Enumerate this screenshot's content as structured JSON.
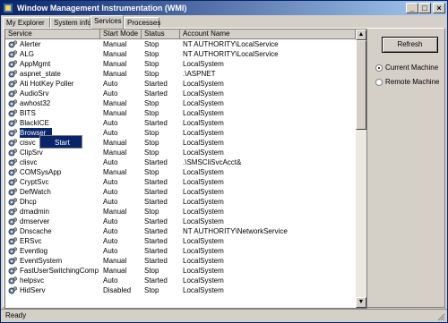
{
  "window": {
    "title": "Window Management Instrumentation (WMI)"
  },
  "tabs": [
    {
      "label": "My Explorer",
      "active": false
    },
    {
      "label": "System info",
      "active": false
    },
    {
      "label": "Services",
      "active": true
    },
    {
      "label": "Processes",
      "active": false
    }
  ],
  "table": {
    "headers": {
      "service": "Service",
      "start_mode": "Start Mode",
      "status": "Status",
      "account": "Account Name"
    },
    "rows": [
      {
        "service": "Alerter",
        "start_mode": "Manual",
        "status": "Stop",
        "account": "NT AUTHORITY\\LocalService"
      },
      {
        "service": "ALG",
        "start_mode": "Manual",
        "status": "Stop",
        "account": "NT AUTHORITY\\LocalService"
      },
      {
        "service": "AppMgmt",
        "start_mode": "Manual",
        "status": "Stop",
        "account": "LocalSystem"
      },
      {
        "service": "aspnet_state",
        "start_mode": "Manual",
        "status": "Stop",
        "account": ".\\ASPNET"
      },
      {
        "service": "Ati HotKey Poller",
        "start_mode": "Auto",
        "status": "Started",
        "account": "LocalSystem"
      },
      {
        "service": "AudioSrv",
        "start_mode": "Auto",
        "status": "Started",
        "account": "LocalSystem"
      },
      {
        "service": "awhost32",
        "start_mode": "Manual",
        "status": "Stop",
        "account": "LocalSystem"
      },
      {
        "service": "BITS",
        "start_mode": "Manual",
        "status": "Stop",
        "account": "LocalSystem"
      },
      {
        "service": "BlackICE",
        "start_mode": "Auto",
        "status": "Started",
        "account": "LocalSystem"
      },
      {
        "service": "Browser",
        "start_mode": "Auto",
        "status": "Stop",
        "account": "LocalSystem",
        "selected": true
      },
      {
        "service": "cisvc",
        "start_mode": "Manual",
        "status": "Stop",
        "account": "LocalSystem"
      },
      {
        "service": "ClipSrv",
        "start_mode": "Manual",
        "status": "Stop",
        "account": "LocalSystem"
      },
      {
        "service": "clisvc",
        "start_mode": "Auto",
        "status": "Started",
        "account": ".\\SMSCliSvcAcct&"
      },
      {
        "service": "COMSysApp",
        "start_mode": "Manual",
        "status": "Stop",
        "account": "LocalSystem"
      },
      {
        "service": "CryptSvc",
        "start_mode": "Auto",
        "status": "Started",
        "account": "LocalSystem"
      },
      {
        "service": "DefWatch",
        "start_mode": "Auto",
        "status": "Started",
        "account": "LocalSystem"
      },
      {
        "service": "Dhcp",
        "start_mode": "Auto",
        "status": "Started",
        "account": "LocalSystem"
      },
      {
        "service": "dmadmin",
        "start_mode": "Manual",
        "status": "Stop",
        "account": "LocalSystem"
      },
      {
        "service": "dmserver",
        "start_mode": "Auto",
        "status": "Started",
        "account": "LocalSystem"
      },
      {
        "service": "Dnscache",
        "start_mode": "Auto",
        "status": "Started",
        "account": "NT AUTHORITY\\NetworkService"
      },
      {
        "service": "ERSvc",
        "start_mode": "Auto",
        "status": "Started",
        "account": "LocalSystem"
      },
      {
        "service": "Eventlog",
        "start_mode": "Auto",
        "status": "Started",
        "account": "LocalSystem"
      },
      {
        "service": "EventSystem",
        "start_mode": "Manual",
        "status": "Started",
        "account": "LocalSystem"
      },
      {
        "service": "FastUserSwitchingComp...",
        "start_mode": "Manual",
        "status": "Stop",
        "account": "LocalSystem"
      },
      {
        "service": "helpsvc",
        "start_mode": "Auto",
        "status": "Started",
        "account": "LocalSystem"
      },
      {
        "service": "HidServ",
        "start_mode": "Disabled",
        "status": "Stop",
        "account": "LocalSystem"
      }
    ]
  },
  "context_menu": {
    "item": "Start"
  },
  "actions": {
    "refresh_label": "Refresh"
  },
  "machine": {
    "options": [
      {
        "label": "Current Machine",
        "selected": true
      },
      {
        "label": "Remote Machine",
        "selected": false
      }
    ]
  },
  "statusbar": {
    "text": "Ready"
  },
  "colors": {
    "title_start": "#0a246a",
    "title_end": "#a6caf0",
    "face": "#d4d0c8",
    "selection": "#0a246a"
  },
  "icons": {
    "service": "gear-icon",
    "app": "wmi-app-icon"
  }
}
